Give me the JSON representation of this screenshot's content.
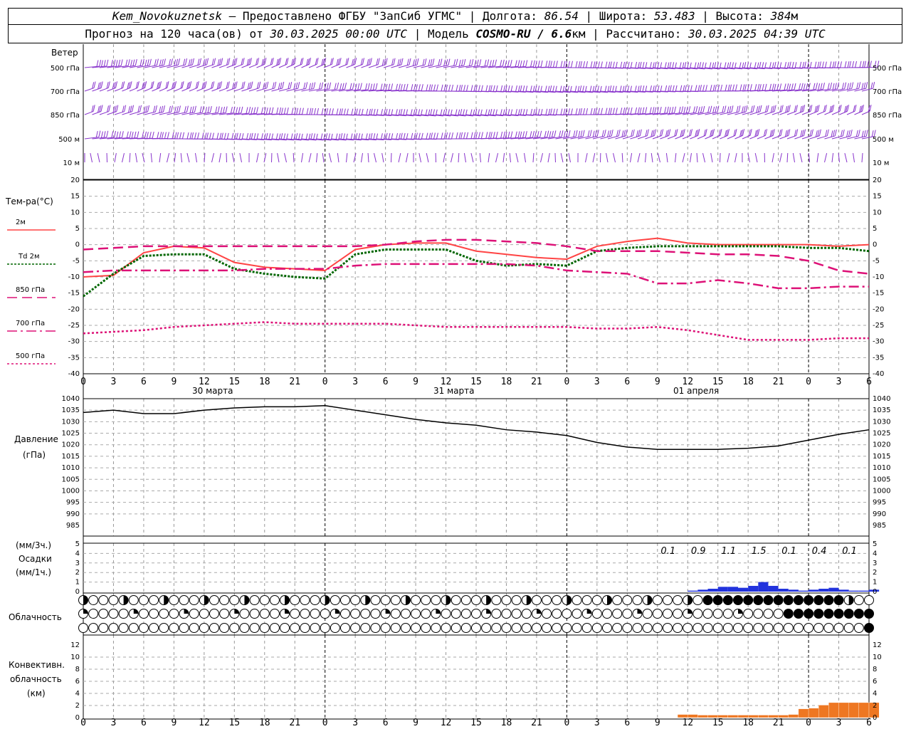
{
  "header": {
    "station": "Kem_Novokuznetsk",
    "provider": " — Предоставлено ФГБУ \"ЗапСиб УГМС\" | Долгота: ",
    "lon": "86.54",
    "lat_label": " | Широта: ",
    "lat": "53.483",
    "alt_label": " | Высота: ",
    "alt": "384",
    "alt_unit": "м",
    "forecast_label": "Прогноз на 120 часа(ов) от ",
    "forecast_start": "30.03.2025 00:00 UTC",
    "model_label": "  | Модель ",
    "model": "COSMO-RU / 6.6",
    "model_unit": "км",
    "calc_label": " | Рассчитано: ",
    "calc_time": "30.03.2025 04:39 UTC"
  },
  "panels": {
    "wind": {
      "title": "Ветер",
      "levels": [
        "500 гПа",
        "700 гПа",
        "850 гПа",
        "500 м",
        "10 м"
      ]
    },
    "temperature": {
      "title": "Тем-ра(°С)",
      "legend": [
        {
          "label": "2м",
          "color": "#ff4444",
          "style": "solid"
        },
        {
          "label": "Td  2м",
          "color": "#006600",
          "style": "dotted"
        },
        {
          "label": "850 гПа",
          "color": "#dd1177",
          "style": "dashed"
        },
        {
          "label": "700 гПа",
          "color": "#dd1177",
          "style": "dashdot"
        },
        {
          "label": "500 гПа",
          "color": "#dd1177",
          "style": "dotted"
        }
      ],
      "y_ticks": [
        "20",
        "15",
        "10",
        "5",
        "0",
        "-5",
        "-10",
        "-15",
        "-20",
        "-25",
        "-30",
        "-35",
        "-40"
      ],
      "dates": [
        "30 марта",
        "31 марта",
        "01 апреля"
      ]
    },
    "pressure": {
      "title": "Давление",
      "unit": "(гПа)",
      "y_ticks": [
        "1040",
        "1035",
        "1030",
        "1025",
        "1020",
        "1015",
        "1010",
        "1005",
        "1000",
        "995",
        "990",
        "985"
      ]
    },
    "precip": {
      "title_top": "(мм/3ч.)",
      "title": "Осадки",
      "title_bot": "(мм/1ч.)",
      "y_ticks": [
        "5",
        "4",
        "3",
        "2",
        "1",
        "0"
      ],
      "totals": [
        "0.1",
        "0.9",
        "1.1",
        "1.5",
        "0.1",
        "0.4",
        "0.1"
      ]
    },
    "clouds": {
      "title": "Облачность"
    },
    "convective": {
      "title1": "Конвективн.",
      "title2": "облачность",
      "title3": "(км)",
      "y_ticks": [
        "12",
        "10",
        "8",
        "6",
        "4",
        "2",
        "0"
      ]
    }
  },
  "x_ticks": [
    "0",
    "3",
    "6",
    "9",
    "12",
    "15",
    "18",
    "21",
    "0",
    "3",
    "6",
    "9",
    "12",
    "15",
    "18",
    "21",
    "0",
    "3",
    "6",
    "9",
    "12",
    "15",
    "18",
    "21",
    "0",
    "3",
    "6"
  ],
  "colors": {
    "wind": "#8833cc",
    "t2m": "#ff4444",
    "td": "#006600",
    "upper": "#dd1177",
    "precip": "#2233dd",
    "conv": "#ee7722"
  },
  "chart_data": [
    {
      "type": "line",
      "title": "Тем-ра(°С)",
      "x": [
        0,
        3,
        6,
        9,
        12,
        15,
        18,
        21,
        24,
        27,
        30,
        33,
        36,
        39,
        42,
        45,
        48,
        51,
        54,
        57,
        60,
        63,
        66,
        69,
        72,
        75,
        78
      ],
      "ylim": [
        -40,
        20
      ],
      "series": [
        {
          "name": "2м",
          "values": [
            -10,
            -9.5,
            -2.5,
            -0.5,
            -1,
            -5.5,
            -7,
            -7.5,
            -8,
            -1.5,
            0,
            0.5,
            0.5,
            -2,
            -3,
            -4,
            -4.5,
            -0.5,
            1,
            2,
            0.5,
            0,
            0,
            0,
            0,
            -0.5,
            0
          ]
        },
        {
          "name": "Td  2м",
          "values": [
            -16,
            -9,
            -3.5,
            -3,
            -3,
            -7.5,
            -9,
            -10,
            -10.5,
            -3,
            -1.5,
            -1.5,
            -1.5,
            -5,
            -6.5,
            -6,
            -6.5,
            -2,
            -1,
            -0.5,
            -0.5,
            -0.5,
            -0.5,
            -0.5,
            -1,
            -1,
            -2
          ]
        },
        {
          "name": "850 гПа",
          "values": [
            -1.5,
            -1,
            -0.5,
            -0.5,
            -0.5,
            -0.5,
            -0.5,
            -0.5,
            -0.5,
            -0.5,
            0,
            1,
            1.5,
            1.5,
            1,
            0.5,
            -0.5,
            -2,
            -2,
            -2,
            -2.5,
            -3,
            -3,
            -3.5,
            -5,
            -8,
            -9
          ]
        },
        {
          "name": "700 гПа",
          "values": [
            -8.5,
            -8,
            -8,
            -8,
            -8,
            -8,
            -7.5,
            -7.5,
            -7.5,
            -6.5,
            -6,
            -6,
            -6,
            -6,
            -6,
            -6.5,
            -8,
            -8.5,
            -9,
            -12,
            -12,
            -11,
            -12,
            -13.5,
            -13.5,
            -13,
            -13
          ]
        },
        {
          "name": "500 гПа",
          "values": [
            -27.5,
            -27,
            -26.5,
            -25.5,
            -25,
            -24.5,
            -24,
            -24.5,
            -24.5,
            -24.5,
            -24.5,
            -25,
            -25.5,
            -25.5,
            -25.5,
            -25.5,
            -25.5,
            -26,
            -26,
            -25.5,
            -26.5,
            -28,
            -29.5,
            -29.5,
            -29.5,
            -29,
            -29
          ]
        }
      ]
    },
    {
      "type": "line",
      "title": "Давление",
      "x": [
        0,
        3,
        6,
        9,
        12,
        15,
        18,
        21,
        24,
        27,
        30,
        33,
        36,
        39,
        42,
        45,
        48,
        51,
        54,
        57,
        60,
        63,
        66,
        69,
        72,
        75,
        78
      ],
      "ylim": [
        985,
        1040
      ],
      "series": [
        {
          "name": "Давление",
          "values": [
            1034,
            1035,
            1033.5,
            1033.5,
            1035,
            1036,
            1036.5,
            1036.5,
            1037,
            1035,
            1033,
            1031,
            1029.5,
            1028.5,
            1026.5,
            1025.5,
            1024,
            1021,
            1019,
            1018,
            1018,
            1018,
            1018.5,
            1019.5,
            1022,
            1024.5,
            1026.5
          ]
        }
      ]
    },
    {
      "type": "bar",
      "title": "Осадки",
      "x": [
        60,
        61,
        62,
        63,
        64,
        65,
        66,
        67,
        68,
        69,
        70,
        71,
        72,
        73,
        74,
        75,
        76,
        77,
        78
      ],
      "ylim": [
        0,
        5
      ],
      "series": [
        {
          "name": "мм/1ч",
          "values": [
            0.1,
            0.2,
            0.3,
            0.5,
            0.5,
            0.4,
            0.6,
            1,
            0.6,
            0.3,
            0.2,
            0.1,
            0.2,
            0.3,
            0.4,
            0.2,
            0.1,
            0.1,
            0.2
          ]
        }
      ]
    },
    {
      "type": "bar",
      "title": "Конвективн. облачность",
      "x": [
        59,
        60,
        61,
        62,
        63,
        64,
        65,
        66,
        67,
        68,
        69,
        70,
        71,
        72,
        73,
        74,
        75,
        76,
        77,
        78
      ],
      "ylim": [
        0,
        13
      ],
      "series": [
        {
          "name": "км",
          "values": [
            0.5,
            0.5,
            0.4,
            0.4,
            0.4,
            0.4,
            0.4,
            0.4,
            0.4,
            0.4,
            0.4,
            0.5,
            1.4,
            1.5,
            2,
            2.4,
            2.4,
            2.4,
            2.4,
            2.4
          ]
        }
      ]
    }
  ]
}
